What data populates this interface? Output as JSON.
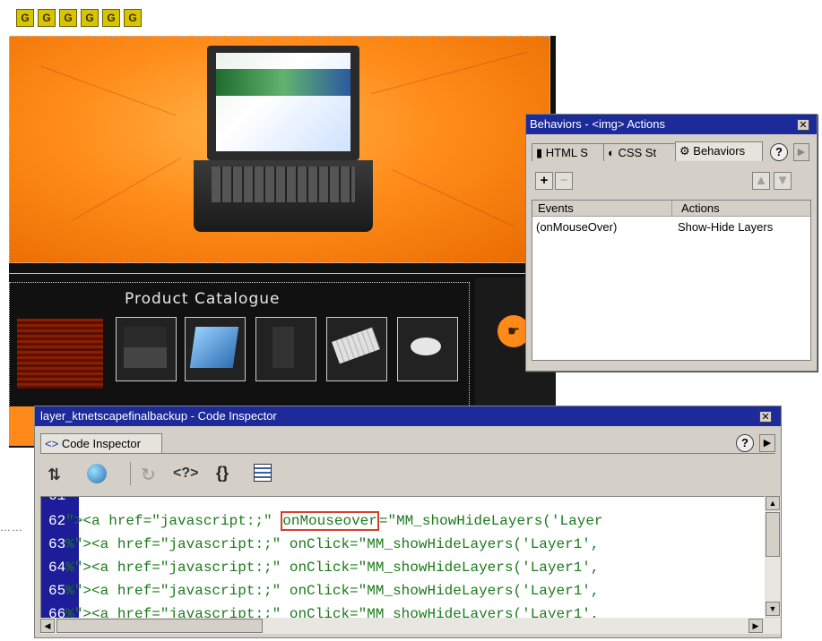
{
  "layer_markers": [
    "G",
    "G",
    "G",
    "G",
    "G",
    "G"
  ],
  "canvas": {
    "catalog_label": "Product Catalogue",
    "thumbnails": [
      "laptop-thumb",
      "monitor-thumb",
      "tower-thumb",
      "keyboard-thumb",
      "mouse-thumb"
    ]
  },
  "behaviors_panel": {
    "title": "Behaviors - <img> Actions",
    "tabs": [
      "HTML S",
      "CSS St",
      "Behaviors"
    ],
    "add_label": "+",
    "remove_label": "−",
    "columns": [
      "Events",
      "Actions"
    ],
    "rows": [
      {
        "event": "(onMouseOver)",
        "action": "Show-Hide Layers"
      }
    ]
  },
  "code_inspector": {
    "title": "layer_ktnetscapefinalbackup - Code Inspector",
    "tab_label": "Code Inspector",
    "toolbar_icons": [
      "file-management-icon",
      "browser-preview-icon",
      "refresh-icon",
      "code-reference-icon",
      "braces-icon",
      "view-options-icon"
    ],
    "top_partial_line": "61",
    "lines": [
      {
        "num": "62",
        "pre": "\"><a href=\"javascript:;\" ",
        "highlight": "onMouseover",
        "post": "=\"MM_showHideLayers('Layer"
      },
      {
        "num": "63",
        "pre": "%\"><a href=\"javascript:;\" onClick=\"MM_showHideLayers('Layer1',",
        "highlight": "",
        "post": ""
      },
      {
        "num": "64",
        "pre": "%\"><a href=\"javascript:;\" onClick=\"MM_showHideLayers('Layer1',",
        "highlight": "",
        "post": ""
      },
      {
        "num": "65",
        "pre": "%\"><a href=\"javascript:;\" onClick=\"MM_showHideLayers('Layer1',",
        "highlight": "",
        "post": ""
      },
      {
        "num": "66",
        "pre": "%\"><a href=\"javascript:;\" onClick=\"MM_showHideLayers('Layer1',",
        "highlight": "",
        "post": ""
      }
    ]
  },
  "colors": {
    "titlebar": "#1c2a9a",
    "gutter": "#1d1d9a",
    "code_text": "#1a7a1a",
    "highlight_box": "#d6402a",
    "hero_orange": "#ff8c1a"
  }
}
